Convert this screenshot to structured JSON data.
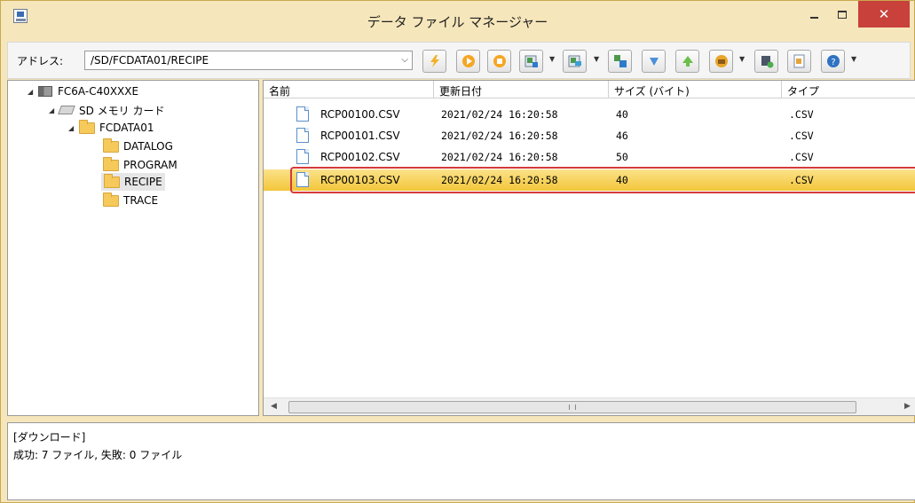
{
  "window": {
    "title": "データ ファイル マネージャー"
  },
  "address": {
    "label": "アドレス:",
    "value": "/SD/FCDATA01/RECIPE"
  },
  "toolbar": {
    "buttons": [
      {
        "name": "connect",
        "icon": "lightning-icon"
      },
      {
        "name": "run",
        "icon": "play-icon"
      },
      {
        "name": "stop",
        "icon": "stop-icon"
      },
      {
        "name": "upload",
        "icon": "upload-icon"
      },
      {
        "name": "download",
        "icon": "download-icon"
      },
      {
        "name": "copy",
        "icon": "copy-icon"
      },
      {
        "name": "move-down",
        "icon": "arrow-down-icon"
      },
      {
        "name": "move-up",
        "icon": "arrow-up-icon"
      },
      {
        "name": "format",
        "icon": "format-icon"
      },
      {
        "name": "check",
        "icon": "check-icon"
      },
      {
        "name": "properties",
        "icon": "properties-icon"
      },
      {
        "name": "help",
        "icon": "help-icon"
      }
    ]
  },
  "tree": {
    "root": "FC6A-C40XXXE",
    "sd_card": "SD メモリ カード",
    "folder": "FCDATA01",
    "children": [
      "DATALOG",
      "PROGRAM",
      "RECIPE",
      "TRACE"
    ],
    "selected": "RECIPE"
  },
  "list": {
    "columns": [
      "名前",
      "更新日付",
      "サイズ (バイト)",
      "タイプ"
    ],
    "rows": [
      {
        "name": "RCP00100.CSV",
        "date": "2021/02/24 16:20:58",
        "size": "40",
        "type": ".CSV"
      },
      {
        "name": "RCP00101.CSV",
        "date": "2021/02/24 16:20:58",
        "size": "46",
        "type": ".CSV"
      },
      {
        "name": "RCP00102.CSV",
        "date": "2021/02/24 16:20:58",
        "size": "50",
        "type": ".CSV"
      },
      {
        "name": "RCP00103.CSV",
        "date": "2021/02/24 16:20:58",
        "size": "40",
        "type": ".CSV"
      }
    ],
    "selected_row": "RCP00103.CSV"
  },
  "log": {
    "header": "[ダウンロード]",
    "message": "成功: 7 ファイル, 失敗: 0 ファイル"
  },
  "colors": {
    "accent": "#f3c63a",
    "frame": "#f6e6bb",
    "close": "#c8413a",
    "highlight_border": "#d63a3a"
  }
}
